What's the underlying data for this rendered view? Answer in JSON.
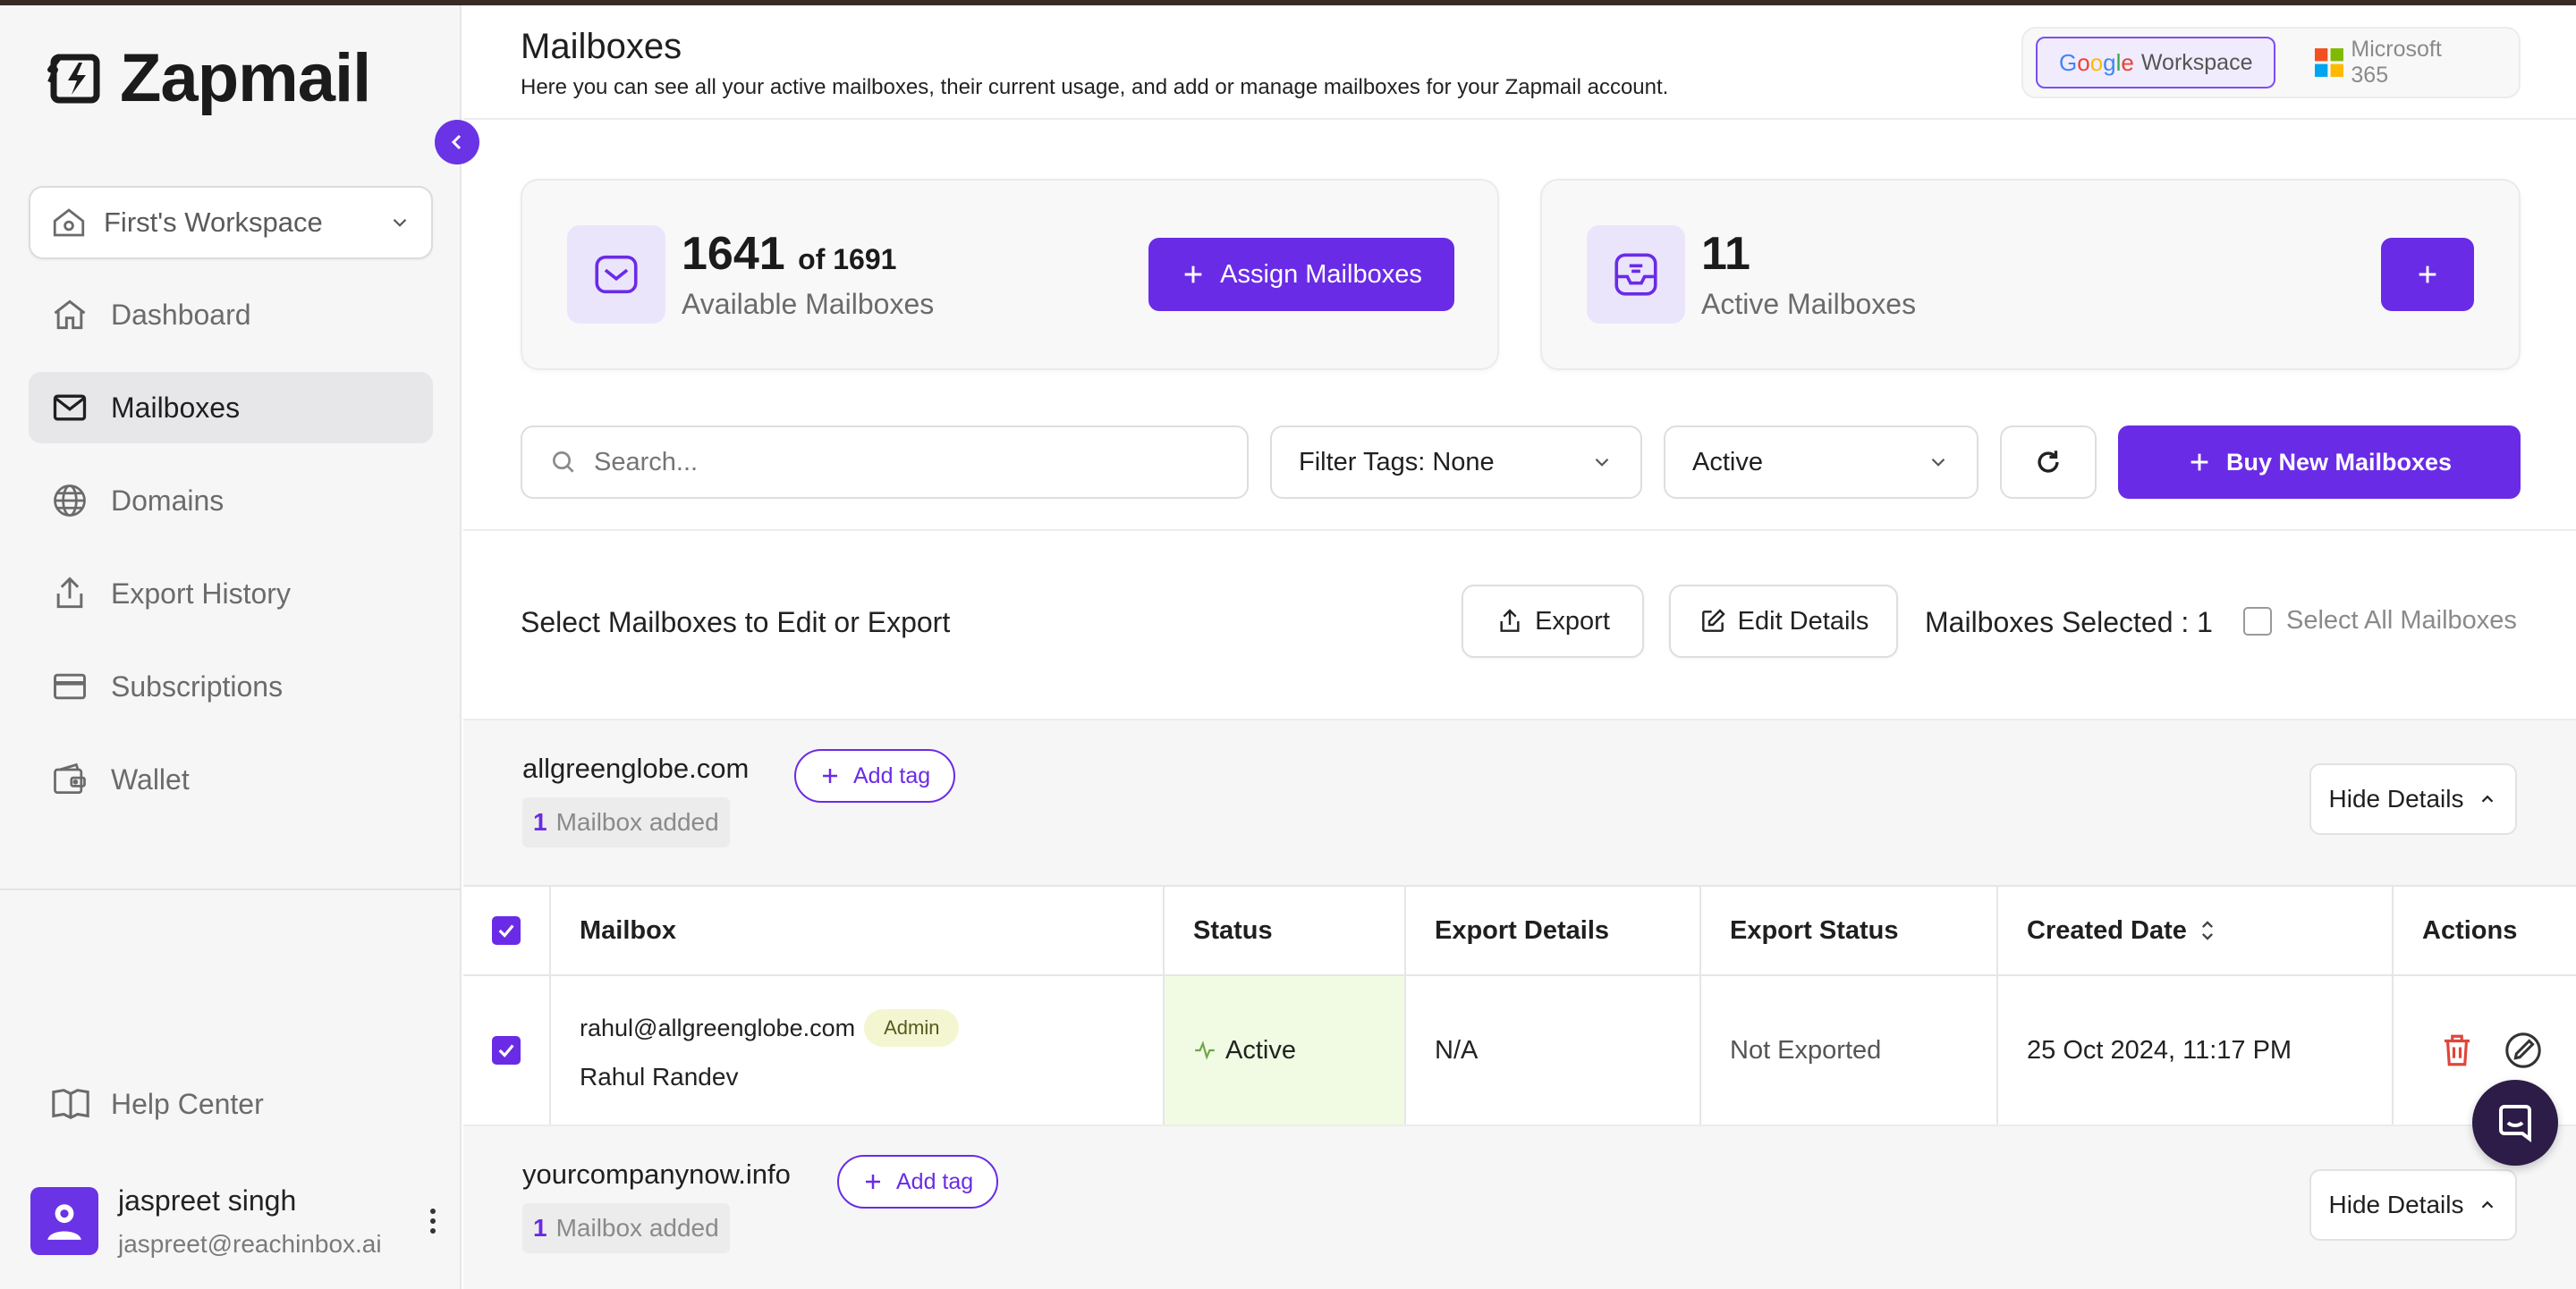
{
  "app": {
    "name": "Zapmail"
  },
  "sidebar": {
    "workspace": "First's Workspace",
    "items": [
      {
        "label": "Dashboard",
        "icon": "home-icon"
      },
      {
        "label": "Mailboxes",
        "icon": "mail-icon",
        "active": true
      },
      {
        "label": "Domains",
        "icon": "globe-icon"
      },
      {
        "label": "Export History",
        "icon": "upload-icon"
      },
      {
        "label": "Subscriptions",
        "icon": "credit-card-icon"
      },
      {
        "label": "Wallet",
        "icon": "wallet-icon"
      }
    ],
    "help": "Help Center",
    "user": {
      "name": "jaspreet singh",
      "email": "jaspreet@reachinbox.ai"
    }
  },
  "header": {
    "title": "Mailboxes",
    "subtitle": "Here you can see all your active mailboxes, their current usage, and add or manage mailboxes for your Zapmail account.",
    "providers": {
      "google": "Workspace",
      "microsoft": "Microsoft 365"
    }
  },
  "stats": {
    "available": {
      "value": "1641",
      "of": "of 1691",
      "label": "Available Mailboxes",
      "button": "Assign Mailboxes"
    },
    "active": {
      "value": "11",
      "label": "Active Mailboxes"
    }
  },
  "toolbar": {
    "search_placeholder": "Search...",
    "filter_tags": "Filter Tags: None",
    "status_filter": "Active",
    "buy_button": "Buy New Mailboxes"
  },
  "selection": {
    "title": "Select Mailboxes to Edit or Export",
    "export": "Export",
    "edit": "Edit Details",
    "selected": "Mailboxes Selected : 1",
    "select_all": "Select All Mailboxes"
  },
  "groups": [
    {
      "domain": "allgreenglobe.com",
      "count": "1",
      "count_label": "Mailbox added",
      "add_tag": "Add tag",
      "hide": "Hide Details"
    },
    {
      "domain": "yourcompanynow.info",
      "count": "1",
      "count_label": "Mailbox added",
      "add_tag": "Add tag",
      "hide": "Hide Details"
    }
  ],
  "table": {
    "columns": [
      "Mailbox",
      "Status",
      "Export Details",
      "Export Status",
      "Created Date",
      "Actions"
    ],
    "rows": [
      {
        "email": "rahul@allgreenglobe.com",
        "role": "Admin",
        "name": "Rahul Randev",
        "status": "Active",
        "export_details": "N/A",
        "export_status": "Not Exported",
        "created": "25 Oct 2024, 11:17 PM"
      }
    ]
  },
  "colors": {
    "accent": "#6a2be6",
    "active_status": "#72a54a",
    "delete": "#e0453a"
  }
}
